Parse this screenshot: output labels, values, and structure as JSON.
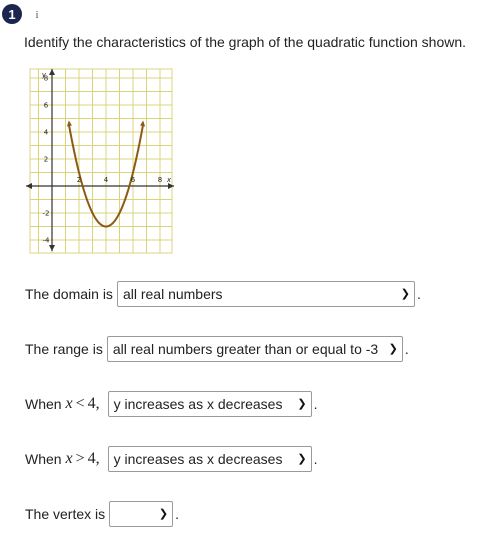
{
  "question": {
    "number": "1",
    "info_icon": "i",
    "prompt": "Identify the characteristics of the graph of the quadratic function shown."
  },
  "graph": {
    "x_axis_label": "x",
    "y_axis_label": "y",
    "x_tick_labels": [
      "2",
      "4",
      "6",
      "8"
    ],
    "y_tick_labels": [
      "8",
      "6",
      "4",
      "2",
      "-2",
      "-4"
    ],
    "curve_color": "#8b5a14",
    "grid_color": "#d8d47c",
    "function": "y = (x - 4)^2 - 3"
  },
  "rows": {
    "domain": {
      "label": "The domain is",
      "value": "all real numbers",
      "end": "."
    },
    "range": {
      "label": "The range is",
      "value": "all real numbers greater than or equal to -3",
      "end": "."
    },
    "when_less": {
      "prefix": "When",
      "var": "x",
      "op": "<",
      "num": "4,",
      "value": "y increases as x decreases",
      "end": "."
    },
    "when_greater": {
      "prefix": "When",
      "var": "x",
      "op": ">",
      "num": "4,",
      "value": "y increases as x decreases",
      "end": "."
    },
    "vertex": {
      "label": "The vertex is",
      "value": "",
      "end": "."
    }
  },
  "icons": {
    "dropdown": "chevron-down-icon",
    "info": "info-icon"
  }
}
